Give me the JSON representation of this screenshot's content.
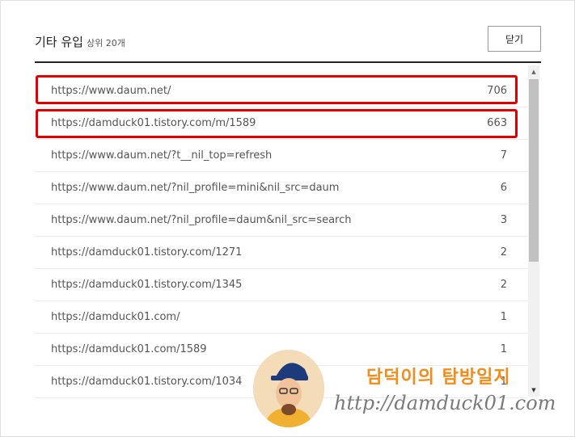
{
  "header": {
    "title": "기타 유입",
    "subtitle": "상위 20개",
    "close_label": "닫기"
  },
  "rows": [
    {
      "url": "https://www.daum.net/",
      "count": "706",
      "highlighted": true
    },
    {
      "url": "https://damduck01.tistory.com/m/1589",
      "count": "663",
      "highlighted": true
    },
    {
      "url": "https://www.daum.net/?t__nil_top=refresh",
      "count": "7"
    },
    {
      "url": "https://www.daum.net/?nil_profile=mini&nil_src=daum",
      "count": "6"
    },
    {
      "url": "https://www.daum.net/?nil_profile=daum&nil_src=search",
      "count": "3"
    },
    {
      "url": "https://damduck01.tistory.com/1271",
      "count": "2"
    },
    {
      "url": "https://damduck01.tistory.com/1345",
      "count": "2"
    },
    {
      "url": "https://damduck01.com/",
      "count": "1"
    },
    {
      "url": "https://damduck01.com/1589",
      "count": "1"
    },
    {
      "url": "https://damduck01.tistory.com/1034",
      "count": "1"
    }
  ],
  "scrollbar": {
    "up_arrow": "▲",
    "down_arrow": "▼"
  },
  "watermark": {
    "title": "담덕이의 탐방일지",
    "url": "http://damduck01.com"
  },
  "colors": {
    "highlight": "#e10000",
    "watermark_title": "#f28c1b"
  }
}
